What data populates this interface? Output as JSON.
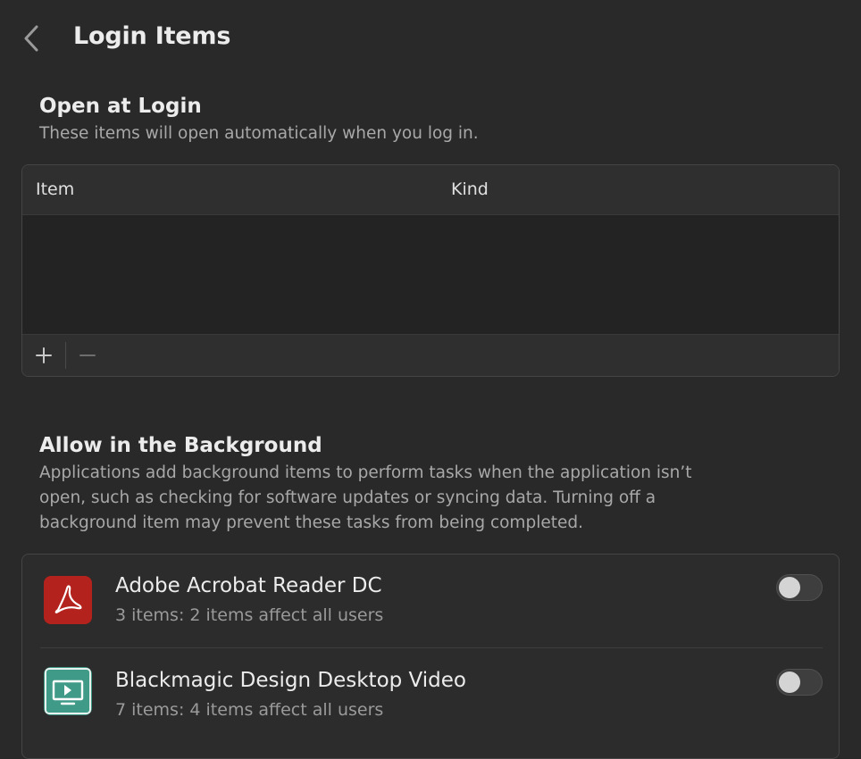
{
  "header": {
    "title": "Login Items"
  },
  "open_at_login": {
    "title": "Open at Login",
    "description": "These items will open automatically when you log in.",
    "columns": [
      "Item",
      "Kind"
    ],
    "rows": [],
    "add_label": "+",
    "remove_label": "−"
  },
  "background": {
    "title": "Allow in the Background",
    "description_lines": [
      "Applications add background items to perform tasks when the application isn’t",
      "open, such as checking for software updates or syncing data. Turning off a",
      "background item may prevent these tasks from being completed."
    ],
    "items": [
      {
        "name": "Adobe Acrobat Reader DC",
        "detail": "3 items: 2 items affect all users",
        "icon": "acrobat-icon",
        "enabled": false
      },
      {
        "name": "Blackmagic Design Desktop Video",
        "detail": "7 items: 4 items affect all users",
        "icon": "desktop-video-icon",
        "enabled": false
      }
    ]
  },
  "colors": {
    "background": "#292929",
    "acrobat_red": "#b3221c",
    "blackmagic_teal": "#3f9a88"
  }
}
